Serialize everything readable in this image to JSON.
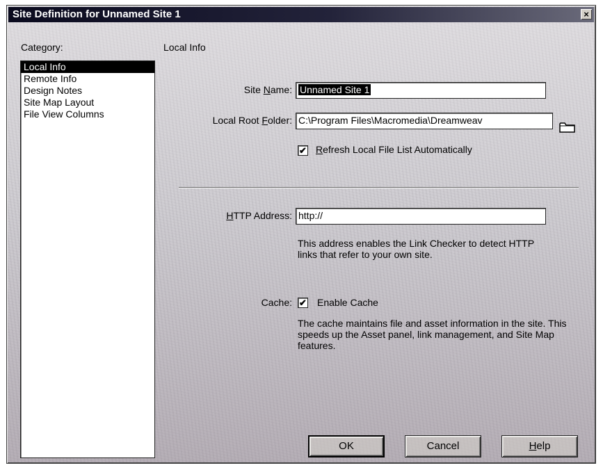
{
  "window": {
    "title": "Site Definition for Unnamed Site 1",
    "close_glyph": "×"
  },
  "category": {
    "header": "Category:",
    "items": [
      "Local Info",
      "Remote Info",
      "Design Notes",
      "Site Map Layout",
      "File View Columns"
    ],
    "selected": "Local Info"
  },
  "section": {
    "title": "Local Info"
  },
  "site_name": {
    "label_prefix": "Site ",
    "label_underlined": "N",
    "label_suffix": "ame:",
    "value": "Unnamed Site 1"
  },
  "local_root": {
    "label_prefix": "Local Root ",
    "label_underlined": "F",
    "label_suffix": "older:",
    "value": "C:\\Program Files\\Macromedia\\Dreamweav",
    "browse_icon": "folder-icon"
  },
  "refresh": {
    "checked": true,
    "check_glyph": "✔",
    "label_underlined": "R",
    "label_rest": "efresh Local File List Automatically"
  },
  "http": {
    "label_underlined": "H",
    "label_rest": "TTP Address:",
    "value": "http://",
    "description": "This address enables the Link Checker to detect HTTP links that refer to your own site."
  },
  "cache": {
    "label": "Cache:",
    "checked": true,
    "check_glyph": "✔",
    "option_label": "Enable Cache",
    "description": "The cache maintains file and asset information in the site.  This speeds up the Asset panel, link management, and Site Map features."
  },
  "buttons": {
    "ok": "OK",
    "cancel": "Cancel",
    "help_underlined": "H",
    "help_rest": "elp"
  }
}
